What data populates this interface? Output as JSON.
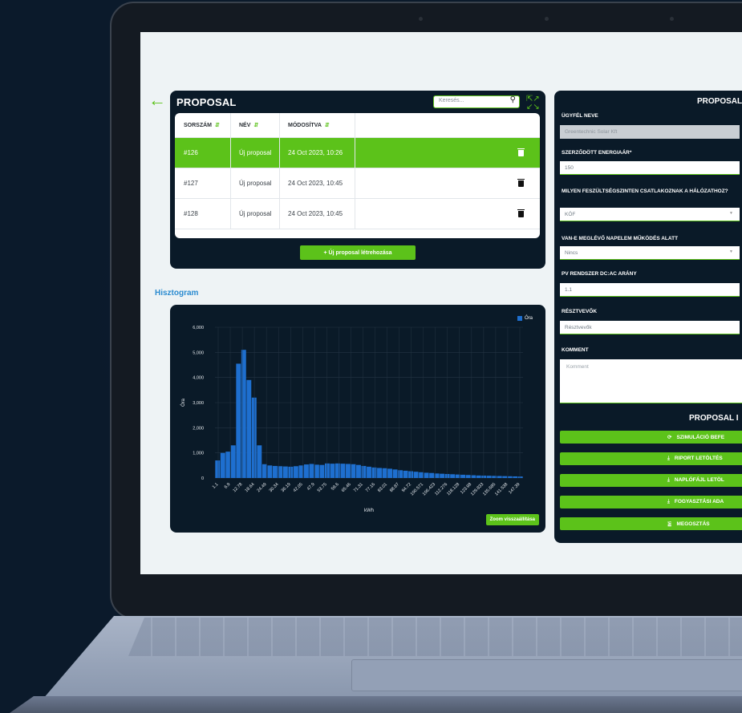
{
  "proposal_list": {
    "title": "PROPOSAL",
    "search_placeholder": "Keresés...",
    "columns": [
      "SORSZÁM",
      "NÉV",
      "MÓDOSÍTVA"
    ],
    "rows": [
      {
        "id": "#126",
        "name": "Új proposal",
        "modified": "24 Oct 2023, 10:26",
        "selected": true
      },
      {
        "id": "#127",
        "name": "Új proposal",
        "modified": "24 Oct 2023, 10:45",
        "selected": false
      },
      {
        "id": "#128",
        "name": "Új proposal",
        "modified": "24 Oct 2023, 10:45",
        "selected": false
      }
    ],
    "new_button": "+ Új proposal létrehozása"
  },
  "histogram": {
    "label": "Hisztogram",
    "zoom_reset": "Zoom visszaállítása"
  },
  "chart_data": {
    "type": "bar",
    "xlabel": "kWh",
    "ylabel": "Óra",
    "ylim": [
      0,
      6000
    ],
    "yticks": [
      "0",
      "1,000",
      "2,000",
      "3,000",
      "4,000",
      "5,000",
      "6,000"
    ],
    "xticks": [
      "1.1",
      "6.9",
      "12.78",
      "18.64",
      "24.49",
      "30.34",
      "36.19",
      "42.05",
      "47.9",
      "53.75",
      "59.6",
      "65.46",
      "71.31",
      "77.16",
      "83.01",
      "88.87",
      "94.72",
      "100.571",
      "106.423",
      "112.276",
      "118.128",
      "123.98",
      "129.833",
      "135.685",
      "141.538",
      "147.39"
    ],
    "legend": "top-right",
    "series": [
      {
        "name": "Óra",
        "color": "#1e6fcf",
        "values": [
          700,
          1000,
          1050,
          1300,
          4550,
          5100,
          3900,
          3200,
          1300,
          550,
          500,
          480,
          470,
          460,
          450,
          470,
          500,
          540,
          560,
          530,
          520,
          580,
          570,
          580,
          570,
          560,
          550,
          520,
          480,
          450,
          420,
          400,
          390,
          370,
          340,
          310,
          290,
          270,
          250,
          230,
          210,
          200,
          180,
          170,
          160,
          150,
          140,
          130,
          120,
          110,
          100,
          95,
          90,
          85,
          80,
          75,
          70,
          65,
          60
        ]
      }
    ]
  },
  "proposal_form": {
    "title": "PROPOSAL",
    "client_label": "ÜGYFÉL NEVE",
    "client_value": "Greentechnic Solar Kft",
    "energy_label": "SZERZŐDÖTT ENERGIAÁR*",
    "energy_value": "150",
    "voltage_label": "MILYEN FESZÜLTSÉGSZINTEN CSATLAKOZNAK A HÁLÓZATHOZ?",
    "voltage_value": "KÖF",
    "existing_label": "VAN-E MEGLÉVŐ NAPELEM MŰKÖDÉS ALATT",
    "existing_value": "Nincs",
    "ratio_label": "PV RENDSZER DC:AC ARÁNY",
    "ratio_value": "1.1",
    "participants_label": "RÉSZTVEVŐK",
    "participants_placeholder": "Résztvevők",
    "comment_label": "KOMMENT",
    "comment_placeholder": "Komment"
  },
  "proposal_actions": {
    "title": "PROPOSAL I",
    "buttons": [
      {
        "label": "SZIMULÁCIÓ BEFE",
        "icon": "refresh-icon"
      },
      {
        "label": "RIPORT LETÖLTÉS",
        "icon": "download-icon"
      },
      {
        "label": "NAPLÓFÁJL LETÖL",
        "icon": "download-icon"
      },
      {
        "label": "FOGYASZTÁSI ADA",
        "icon": "download-icon"
      },
      {
        "label": "MEGOSZTÁS",
        "icon": "share-icon"
      }
    ]
  }
}
